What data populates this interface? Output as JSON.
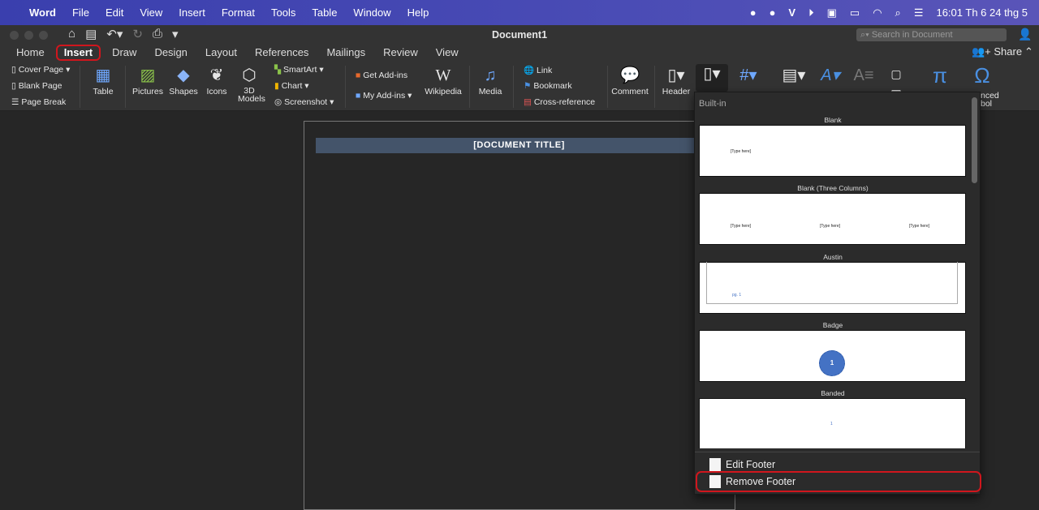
{
  "menubar": {
    "app": "Word",
    "items": [
      "File",
      "Edit",
      "View",
      "Insert",
      "Format",
      "Tools",
      "Table",
      "Window",
      "Help"
    ],
    "clock": "16:01 Th 6 24 thg 5"
  },
  "window": {
    "title": "Document1",
    "search_placeholder": "Search in Document",
    "share": "Share"
  },
  "tabs": [
    "Home",
    "Insert",
    "Draw",
    "Design",
    "Layout",
    "References",
    "Mailings",
    "Review",
    "View"
  ],
  "active_tab": "Insert",
  "ribbon": {
    "cover_page": "Cover Page",
    "blank_page": "Blank Page",
    "page_break": "Page Break",
    "table": "Table",
    "pictures": "Pictures",
    "shapes": "Shapes",
    "icons": "Icons",
    "models_3d": "3D Models",
    "smartart": "SmartArt",
    "chart": "Chart",
    "screenshot": "Screenshot",
    "get_addins": "Get Add-ins",
    "my_addins": "My Add-ins",
    "wikipedia": "Wikipedia",
    "media": "Media",
    "link": "Link",
    "bookmark": "Bookmark",
    "cross_reference": "Cross-reference",
    "comment": "Comment",
    "header": "Header",
    "advanced_symbol_partial": "nced",
    "symbol_partial": "bol"
  },
  "document": {
    "title_placeholder": "[DOCUMENT TITLE]"
  },
  "footer_menu": {
    "section": "Built-in",
    "items": [
      {
        "label": "Blank",
        "text": "[Type here]"
      },
      {
        "label": "Blank (Three Columns)",
        "texts": [
          "[Type here]",
          "[Type here]",
          "[Type here]"
        ]
      },
      {
        "label": "Austin",
        "text": "pg. 1"
      },
      {
        "label": "Badge",
        "text": "1"
      },
      {
        "label": "Banded",
        "text": "1"
      }
    ],
    "edit": "Edit Footer",
    "remove": "Remove Footer"
  },
  "colors": {
    "highlight": "#d0161d",
    "title_bar": "#44546a",
    "badge": "#4472c4"
  }
}
